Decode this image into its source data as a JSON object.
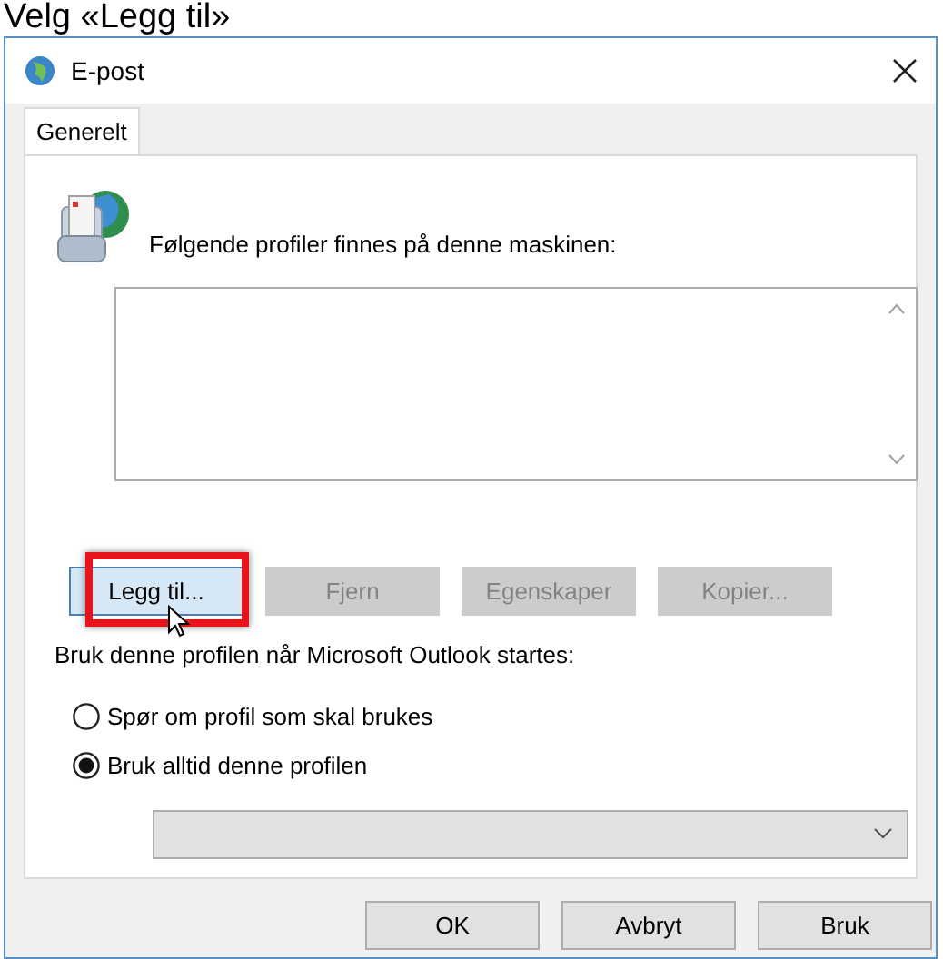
{
  "caption": "Velg «Legg til»",
  "window": {
    "title": "E-post"
  },
  "tabs": [
    {
      "label": "Generelt",
      "selected": true
    }
  ],
  "profiles_label": "Følgende profiler finnes på denne maskinen:",
  "profile_buttons": [
    {
      "label": "Legg til...",
      "disabled": false,
      "highlighted": true
    },
    {
      "label": "Fjern",
      "disabled": true,
      "highlighted": false
    },
    {
      "label": "Egenskaper",
      "disabled": true,
      "highlighted": false
    },
    {
      "label": "Kopier...",
      "disabled": true,
      "highlighted": false
    }
  ],
  "startup_label": "Bruk denne profilen når Microsoft Outlook startes:",
  "startup_options": [
    {
      "label": "Spør om profil som skal brukes",
      "selected": false
    },
    {
      "label": "Bruk alltid denne profilen",
      "selected": true
    }
  ],
  "footer_buttons": [
    {
      "label": "OK"
    },
    {
      "label": "Avbryt"
    },
    {
      "label": "Bruk"
    }
  ]
}
